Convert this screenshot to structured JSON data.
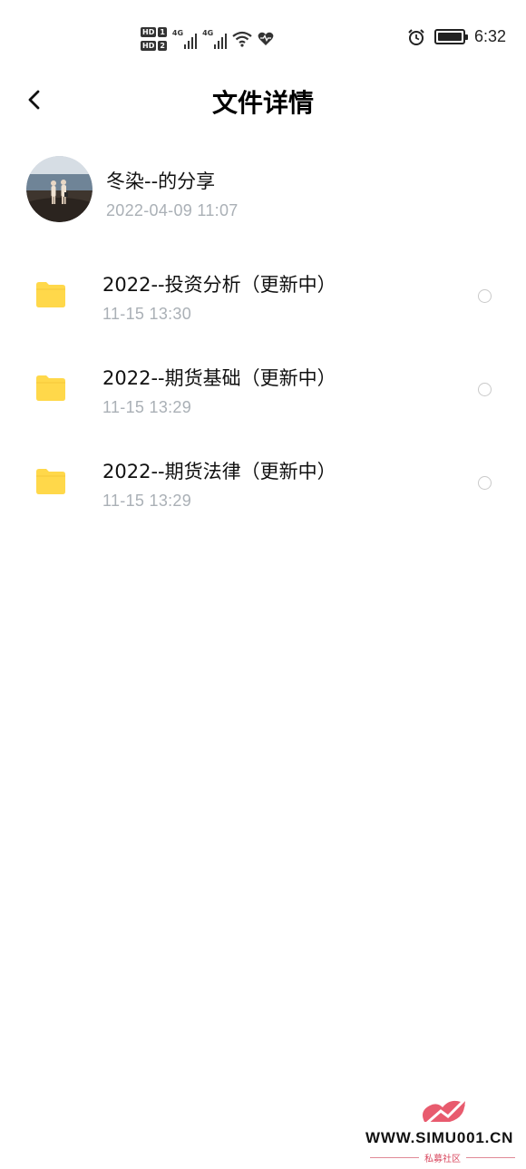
{
  "status_bar": {
    "hd1": "HD",
    "hd1_num": "1",
    "hd2": "HD",
    "hd2_num": "2",
    "sim1_network": "4G",
    "sim2_network": "4G",
    "time": "6:32",
    "icons": [
      "signal-icon",
      "wifi-icon",
      "heart-health-icon",
      "alarm-icon",
      "battery-icon"
    ]
  },
  "header": {
    "title": "文件详情",
    "back_icon": "chevron-left-icon"
  },
  "sharer": {
    "name": "冬染--的分享",
    "time": "2022-04-09  11:07"
  },
  "files": [
    {
      "name": "2022--投资分析（更新中）",
      "time": "11-15  13:30",
      "icon": "folder-icon"
    },
    {
      "name": "2022--期货基础（更新中）",
      "time": "11-15  13:29",
      "icon": "folder-icon"
    },
    {
      "name": "2022--期货法律（更新中）",
      "time": "11-15  13:29",
      "icon": "folder-icon"
    }
  ],
  "watermark": {
    "text": "WWW.SIMU001.CN",
    "subtitle": "私募社区"
  },
  "colors": {
    "folder": "#FFD84A",
    "secondary_text": "#AAB0B6",
    "watermark_accent": "#D9485F"
  }
}
